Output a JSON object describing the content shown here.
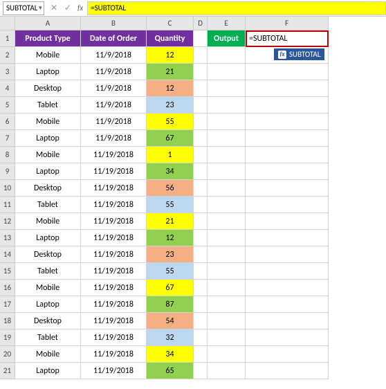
{
  "formula_bar": {
    "name_box": "SUBTOTAL",
    "cancel": "✕",
    "confirm": "✓",
    "fx": "fx",
    "formula": "=SUBTOTAL"
  },
  "columns": [
    "A",
    "B",
    "C",
    "D",
    "E",
    "F"
  ],
  "row_numbers": [
    "1",
    "2",
    "3",
    "4",
    "5",
    "6",
    "7",
    "8",
    "9",
    "10",
    "11",
    "12",
    "13",
    "14",
    "15",
    "16",
    "17",
    "18",
    "19",
    "20",
    "21"
  ],
  "headers": {
    "A": "Product Type",
    "B": "Date of Order",
    "C": "Quantity"
  },
  "output_label": "Output",
  "editing_value": "=SUBTOTAL",
  "tooltip": {
    "icon": "fx",
    "text": "SUBTOTAL"
  },
  "rows": [
    {
      "a": "Mobile",
      "b": "11/9/2018",
      "c": "12",
      "cc": "c-yellow"
    },
    {
      "a": "Laptop",
      "b": "11/9/2018",
      "c": "21",
      "cc": "c-green"
    },
    {
      "a": "Desktop",
      "b": "11/9/2018",
      "c": "12",
      "cc": "c-orange"
    },
    {
      "a": "Tablet",
      "b": "11/9/2018",
      "c": "23",
      "cc": "c-blue"
    },
    {
      "a": "Mobile",
      "b": "11/9/2018",
      "c": "55",
      "cc": "c-yellow"
    },
    {
      "a": "Laptop",
      "b": "11/9/2018",
      "c": "67",
      "cc": "c-green"
    },
    {
      "a": "Mobile",
      "b": "11/19/2018",
      "c": "1",
      "cc": "c-yellow"
    },
    {
      "a": "Laptop",
      "b": "11/19/2018",
      "c": "34",
      "cc": "c-green"
    },
    {
      "a": "Desktop",
      "b": "11/19/2018",
      "c": "56",
      "cc": "c-orange"
    },
    {
      "a": "Tablet",
      "b": "11/19/2018",
      "c": "55",
      "cc": "c-blue"
    },
    {
      "a": "Mobile",
      "b": "11/19/2018",
      "c": "21",
      "cc": "c-yellow"
    },
    {
      "a": "Laptop",
      "b": "11/19/2018",
      "c": "12",
      "cc": "c-green"
    },
    {
      "a": "Desktop",
      "b": "11/19/2018",
      "c": "23",
      "cc": "c-orange"
    },
    {
      "a": "Tablet",
      "b": "11/19/2018",
      "c": "55",
      "cc": "c-blue"
    },
    {
      "a": "Mobile",
      "b": "11/19/2018",
      "c": "67",
      "cc": "c-yellow"
    },
    {
      "a": "Laptop",
      "b": "11/19/2018",
      "c": "87",
      "cc": "c-green"
    },
    {
      "a": "Desktop",
      "b": "11/19/2018",
      "c": "54",
      "cc": "c-orange"
    },
    {
      "a": "Tablet",
      "b": "11/19/2018",
      "c": "32",
      "cc": "c-blue"
    },
    {
      "a": "Mobile",
      "b": "11/19/2018",
      "c": "34",
      "cc": "c-yellow"
    },
    {
      "a": "Laptop",
      "b": "11/19/2018",
      "c": "65",
      "cc": "c-green"
    }
  ]
}
